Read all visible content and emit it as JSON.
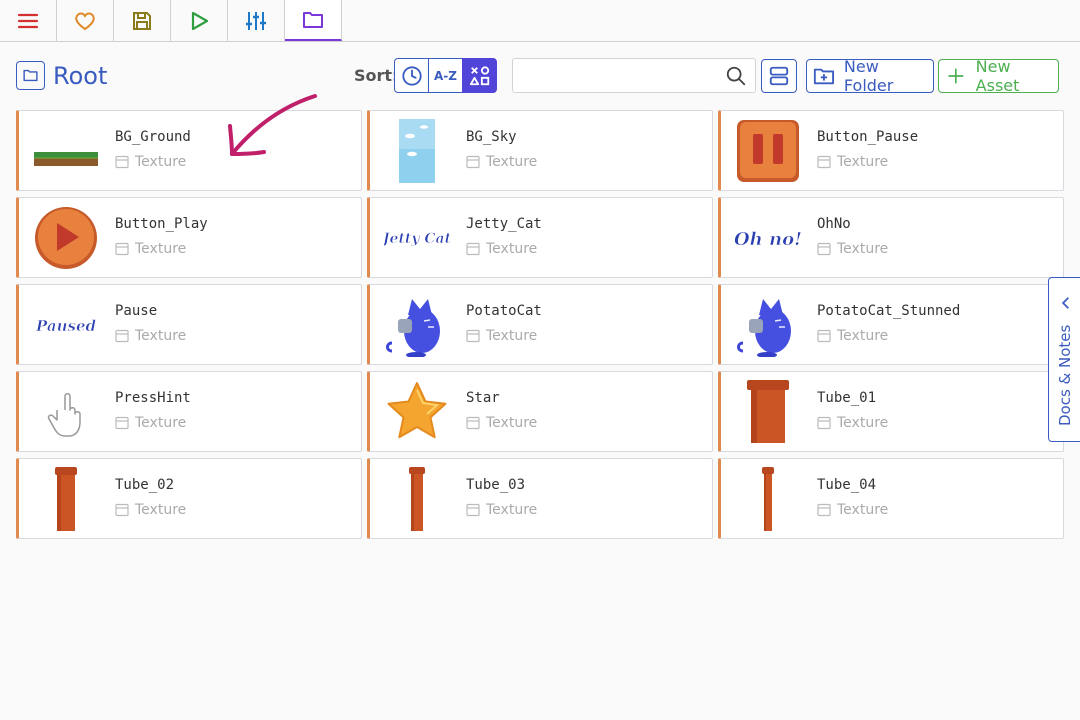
{
  "toolbar": {
    "tabs": [
      {
        "icon": "menu-icon",
        "color": "#d32f2f"
      },
      {
        "icon": "heart-icon",
        "color": "#e08a2c"
      },
      {
        "icon": "save-icon",
        "color": "#8a7a1a"
      },
      {
        "icon": "play-icon",
        "color": "#2e9e3e"
      },
      {
        "icon": "sliders-icon",
        "color": "#1e78c8"
      },
      {
        "icon": "folder-icon",
        "color": "#7a38d8",
        "active": true
      }
    ]
  },
  "header": {
    "title": "Root",
    "sort_label": "Sort:",
    "sort_options": [
      {
        "icon": "clock-icon",
        "active": false
      },
      {
        "label": "A-Z",
        "active": false
      },
      {
        "icon": "shapes-icon",
        "active": true
      }
    ],
    "search": {
      "value": "",
      "placeholder": ""
    },
    "new_folder_label": "New Folder",
    "new_asset_label": "New Asset"
  },
  "assets": [
    {
      "name": "BG_Ground",
      "type": "Texture",
      "thumb": "ground"
    },
    {
      "name": "BG_Sky",
      "type": "Texture",
      "thumb": "sky"
    },
    {
      "name": "Button_Pause",
      "type": "Texture",
      "thumb": "pause-button"
    },
    {
      "name": "Button_Play",
      "type": "Texture",
      "thumb": "play-button"
    },
    {
      "name": "Jetty_Cat",
      "type": "Texture",
      "thumb": "jetty-cat-text"
    },
    {
      "name": "OhNo",
      "type": "Texture",
      "thumb": "ohno-text"
    },
    {
      "name": "Pause",
      "type": "Texture",
      "thumb": "paused-text"
    },
    {
      "name": "PotatoCat",
      "type": "Texture",
      "thumb": "cat"
    },
    {
      "name": "PotatoCat_Stunned",
      "type": "Texture",
      "thumb": "cat"
    },
    {
      "name": "PressHint",
      "type": "Texture",
      "thumb": "hand"
    },
    {
      "name": "Star",
      "type": "Texture",
      "thumb": "star"
    },
    {
      "name": "Tube_01",
      "type": "Texture",
      "thumb": "tube-wide"
    },
    {
      "name": "Tube_02",
      "type": "Texture",
      "thumb": "tube"
    },
    {
      "name": "Tube_03",
      "type": "Texture",
      "thumb": "tube-thin"
    },
    {
      "name": "Tube_04",
      "type": "Texture",
      "thumb": "tube-thinner"
    }
  ],
  "thumb_text": {
    "jetty": "Jetty Cat",
    "ohno": "Oh no!",
    "paused": "Paused"
  },
  "docs_panel": {
    "label": "Docs & Notes"
  },
  "colors": {
    "accent": "#3a5bbf",
    "card_stripe": "#e08a50",
    "new_asset": "#4caf50",
    "annotation": "#c0206a"
  }
}
